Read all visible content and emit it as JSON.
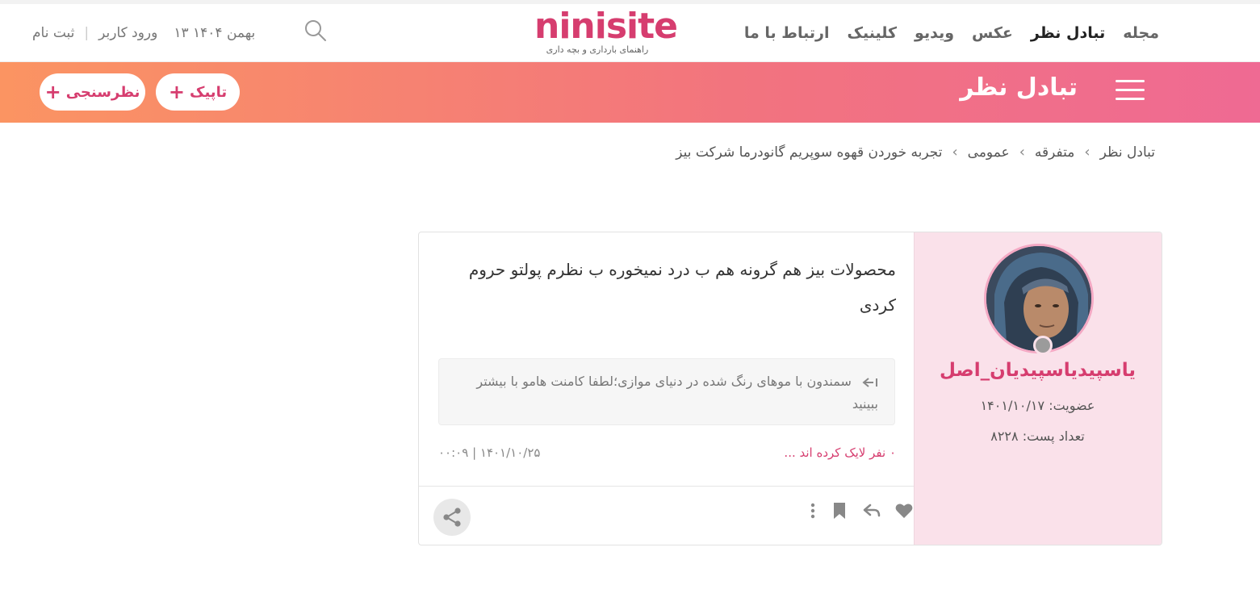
{
  "nav": {
    "items": [
      "مجله",
      "تبادل نظر",
      "عکس",
      "ویدیو",
      "کلینیک",
      "ارتباط با ما"
    ],
    "active": "تبادل نظر"
  },
  "logo": {
    "word": "ninisite",
    "tagline": "راهنمای بارداری و بچه داری"
  },
  "userbar": {
    "date": "۱۳ بهمن ۱۴۰۴",
    "login": "ورود کاربر",
    "register": "ثبت نام"
  },
  "band": {
    "title": "تبادل نظر",
    "topic_button": "تاپیک",
    "poll_button": "نظرسنجی",
    "gradient_start": "#fb9462",
    "gradient_end": "#ef6a93"
  },
  "breadcrumb": [
    "تبادل نظر",
    "متفرقه",
    "عمومی",
    "تجربه خوردن قهوه سوپریم گانودرما شرکت بیز"
  ],
  "post": {
    "author": {
      "name": "یاسپیدیاسپیدیان_اصل",
      "membership_label": "عضویت:",
      "membership_date": "۱۴۰۱/۱۰/۱۷",
      "posts_label": "تعداد پست:",
      "posts_count": "۸۲۲۸"
    },
    "text": "محصولات بیز هم گرونه هم ب درد نمیخوره ب نظرم پولتو حروم کردی",
    "reply_quote": "سمندون با موهای رنگ شده در دنیای موازی؛لطفا کامنت هامو با بیشتر ببینید",
    "likes_text": "۰ نفر لایک کرده اند ...",
    "date": "۱۴۰۱/۱۰/۲۵",
    "time": "۰۰:۰۹",
    "accent_color": "#d63d6f"
  },
  "icons": {
    "search": "search-icon",
    "menu": "hamburger-menu-icon",
    "heart": "heart-icon",
    "reply": "reply-icon",
    "bookmark": "bookmark-icon",
    "more": "more-vertical-icon",
    "share": "share-icon"
  }
}
